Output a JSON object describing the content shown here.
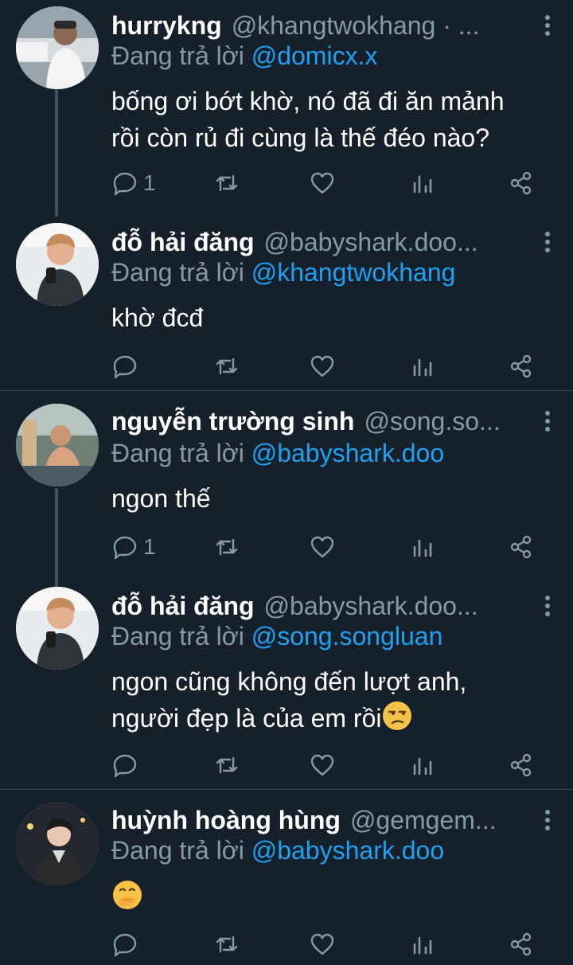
{
  "colors": {
    "background": "#15202b",
    "name": "#ffffff",
    "muted": "#8899a6",
    "mention": "#1da1f2",
    "divider": "#38444d",
    "thread_line": "#3d5466"
  },
  "reply_prefix": "Đang trả lời",
  "tweets": [
    {
      "name": "hurrykng",
      "handle": "@khangtwokhang · ...",
      "reply_to": "@domicx.x",
      "body_lines": [
        "bống ơi bớt khờ, nó đã đi ăn mảnh",
        "rồi còn rủ đi cùng là thế đéo nào?"
      ],
      "reply_count": "1"
    },
    {
      "name": "đỗ hải đăng",
      "handle": "@babyshark.doo...",
      "reply_to": "@khangtwokhang",
      "body_lines": [
        "khờ đcđ"
      ],
      "reply_count": ""
    },
    {
      "name": "nguyễn trường sinh",
      "handle": "@song.so...",
      "reply_to": "@babyshark.doo",
      "body_lines": [
        "ngon thế"
      ],
      "reply_count": "1"
    },
    {
      "name": "đỗ hải đăng",
      "handle": "@babyshark.doo...",
      "reply_to": "@song.songluan",
      "body_lines": [
        "ngon cũng không đến lượt anh,",
        "người đẹp là của em rồi"
      ],
      "body_emoji": "unamused-face",
      "reply_count": ""
    },
    {
      "name": "huỳnh hoàng hùng",
      "handle": "@gemgem...",
      "reply_to": "@babyshark.doo",
      "body_lines": [
        ""
      ],
      "body_emoji": "face-with-hand-over-mouth",
      "reply_count": ""
    }
  ],
  "icons": {
    "more": "more-vertical-icon",
    "reply": "reply-icon",
    "retweet": "retweet-icon",
    "like": "heart-icon",
    "analytics": "analytics-icon",
    "share": "share-icon"
  }
}
